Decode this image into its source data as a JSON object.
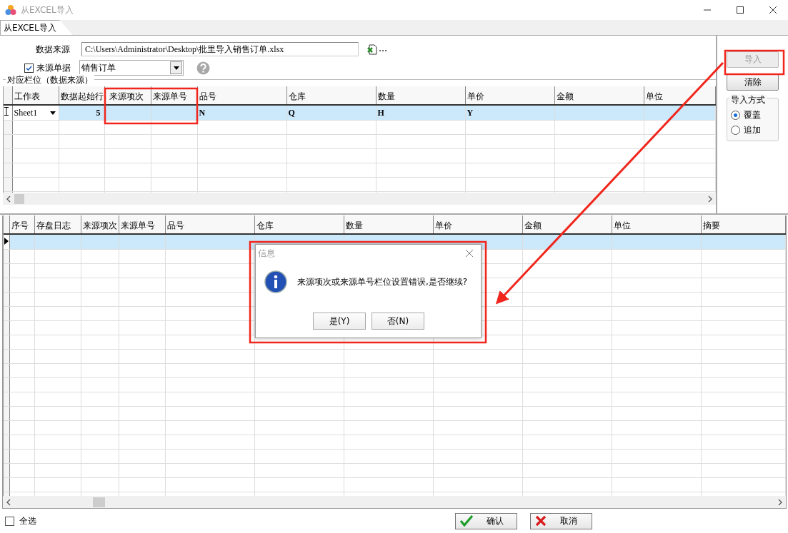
{
  "window": {
    "title": "从EXCEL导入"
  },
  "tabs": [
    {
      "label": "从EXCEL导入",
      "selected": true
    }
  ],
  "form": {
    "data_source": {
      "label": "数据来源",
      "value": "C:\\Users\\Administrator\\Desktop\\批里导入销售订单.xlsx"
    },
    "source_doc": {
      "label": "来源单据",
      "checked": true,
      "value": "销售订单"
    }
  },
  "mapping": {
    "title": "对应栏位（数据来源）",
    "columns": [
      "工作表",
      "数据起始行",
      "来源项次",
      "来源单号",
      "品号",
      "仓库",
      "数量",
      "单价",
      "金额",
      "单位"
    ],
    "rows": [
      {
        "selected": true,
        "cells": [
          "Sheet1",
          "5",
          null,
          null,
          "N",
          "Q",
          "H",
          "Y",
          null,
          null
        ]
      }
    ]
  },
  "side": {
    "buttons": [
      {
        "label": "导入",
        "disabled": true
      },
      {
        "label": "清除",
        "disabled": false
      }
    ],
    "import_mode": {
      "title": "导入方式",
      "options": [
        {
          "label": "覆盖",
          "selected": true
        },
        {
          "label": "追加",
          "selected": false
        }
      ]
    }
  },
  "detail": {
    "columns": [
      "序号",
      "存盘日志",
      "来源项次",
      "来源单号",
      "品号",
      "仓库",
      "数量",
      "单价",
      "金额",
      "单位",
      "摘要"
    ],
    "rows": [
      {
        "selected": true
      }
    ]
  },
  "footer": {
    "select_all": {
      "label": "全选",
      "checked": false
    },
    "buttons": [
      {
        "label": "确认",
        "kind": "ok"
      },
      {
        "label": "取消",
        "kind": "cancel"
      }
    ]
  },
  "dialog": {
    "title": "信息",
    "message": "来源项次或来源单号栏位设置错误,是否继续?",
    "buttons": [
      "是(Y)",
      "否(N)"
    ]
  }
}
